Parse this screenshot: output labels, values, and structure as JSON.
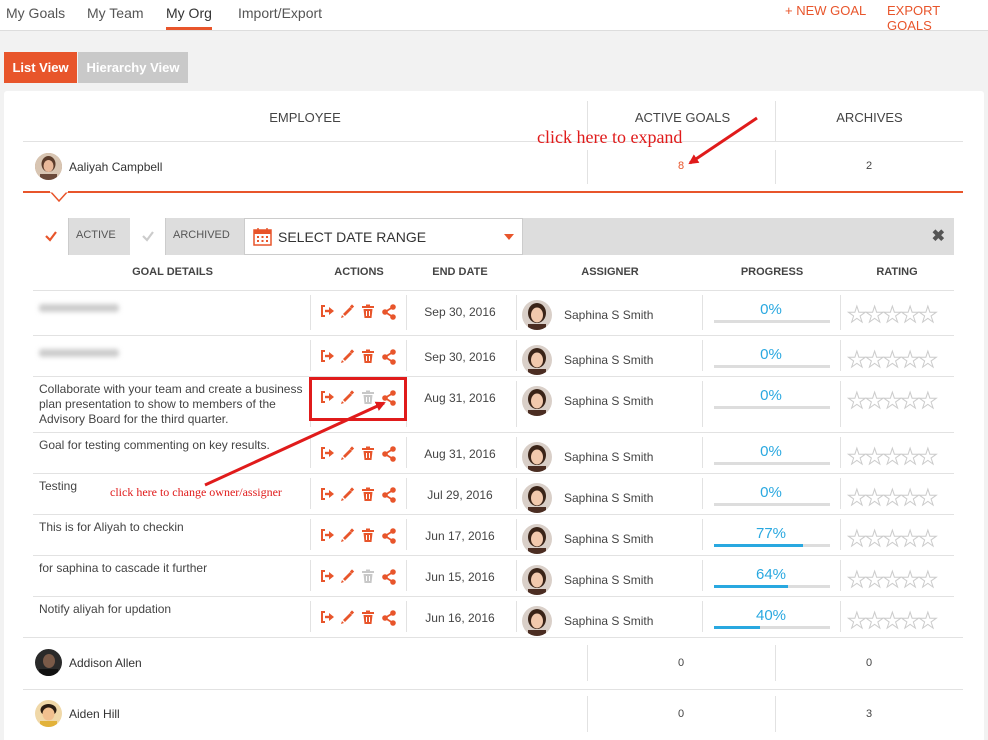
{
  "nav": {
    "tabs": [
      {
        "label": "My Goals"
      },
      {
        "label": "My Team"
      },
      {
        "label": "My Org"
      },
      {
        "label": "Import/Export"
      }
    ],
    "new_goal": "+ NEW GOAL",
    "export_goals": "EXPORT GOALS"
  },
  "views": {
    "list": "List View",
    "hierarchy": "Hierarchy View"
  },
  "table": {
    "col_employee": "EMPLOYEE",
    "col_active": "ACTIVE GOALS",
    "col_archives": "ARCHIVES"
  },
  "employees": [
    {
      "name": "Aaliyah Campbell",
      "active": "8",
      "archives": "2"
    },
    {
      "name": "Addison Allen",
      "active": "0",
      "archives": "0"
    },
    {
      "name": "Aiden Hill",
      "active": "0",
      "archives": "3"
    }
  ],
  "filter": {
    "active_label": "ACTIVE",
    "archived_label": "ARCHIVED",
    "date_range": "SELECT DATE RANGE"
  },
  "goals_header": {
    "details": "GOAL DETAILS",
    "actions": "ACTIONS",
    "end_date": "END DATE",
    "assigner": "ASSIGNER",
    "progress": "PROGRESS",
    "rating": "RATING"
  },
  "goals": [
    {
      "title": "",
      "end_date": "Sep 30, 2016",
      "assigner": "Saphina S Smith",
      "progress": "0%",
      "progress_value": 0
    },
    {
      "title": "",
      "end_date": "Sep 30, 2016",
      "assigner": "Saphina S Smith",
      "progress": "0%",
      "progress_value": 0
    },
    {
      "title": "Collaborate with your team and create a business plan presentation to show to members of the Advisory Board for the third quarter.",
      "end_date": "Aug 31, 2016",
      "assigner": "Saphina S Smith",
      "progress": "0%",
      "progress_value": 0
    },
    {
      "title": "Goal for testing commenting on key results.",
      "end_date": "Aug 31, 2016",
      "assigner": "Saphina S Smith",
      "progress": "0%",
      "progress_value": 0
    },
    {
      "title": "Testing",
      "end_date": "Jul 29, 2016",
      "assigner": "Saphina S Smith",
      "progress": "0%",
      "progress_value": 0
    },
    {
      "title": "This is for Aliyah to checkin",
      "end_date": "Jun 17, 2016",
      "assigner": "Saphina S Smith",
      "progress": "77%",
      "progress_value": 77
    },
    {
      "title": "for saphina to cascade it further",
      "end_date": "Jun 15, 2016",
      "assigner": "Saphina S Smith",
      "progress": "64%",
      "progress_value": 64
    },
    {
      "title": "Notify aliyah for updation",
      "end_date": "Jun 16, 2016",
      "assigner": "Saphina S Smith",
      "progress": "40%",
      "progress_value": 40
    }
  ],
  "annotations": {
    "expand": "click here to expand",
    "change_owner": "click here to change owner/assigner"
  },
  "colors": {
    "accent": "#e8552b",
    "progress": "#29a8e0",
    "annotation": "#e01b1b"
  }
}
